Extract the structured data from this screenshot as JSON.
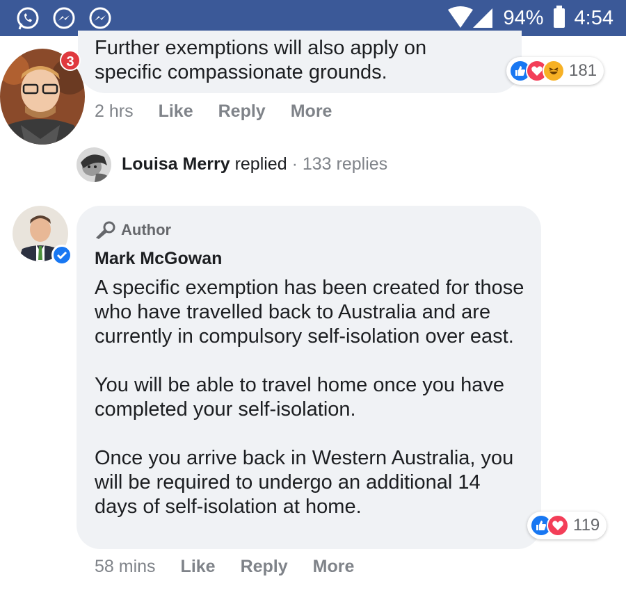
{
  "status_bar": {
    "battery_percent": "94%",
    "time": "4:54",
    "left_icons": [
      "whatsapp-icon",
      "messenger-icon",
      "messenger-icon"
    ]
  },
  "comment1": {
    "text_line1": "Further exemptions will also apply on",
    "text_line2": "specific compassionate grounds.",
    "time": "2 hrs",
    "like": "Like",
    "reply": "Reply",
    "more": "More",
    "reaction_count": "181",
    "notification_badge": "3"
  },
  "replied_row": {
    "name": "Louisa Merry",
    "action": "replied",
    "separator": "·",
    "replies": "133 replies"
  },
  "comment2": {
    "author_label": "Author",
    "name": "Mark McGowan",
    "para1": "A specific exemption has been created for those who have travelled back to Australia and are currently in compulsory self-isolation over east.",
    "para2": "You will be able to travel home once you have completed your self-isolation.",
    "para3": "Once you arrive back in Western Australia, you will be required to undergo an additional 14 days of self-isolation at home.",
    "time": "58 mins",
    "like": "Like",
    "reply": "Reply",
    "more": "More",
    "reaction_count": "119"
  },
  "colors": {
    "status_bar": "#3b5998",
    "bubble": "#f0f2f5",
    "like": "#1877f2",
    "love": "#f33e58",
    "haha": "#f7b125",
    "badge": "#e0393e"
  }
}
